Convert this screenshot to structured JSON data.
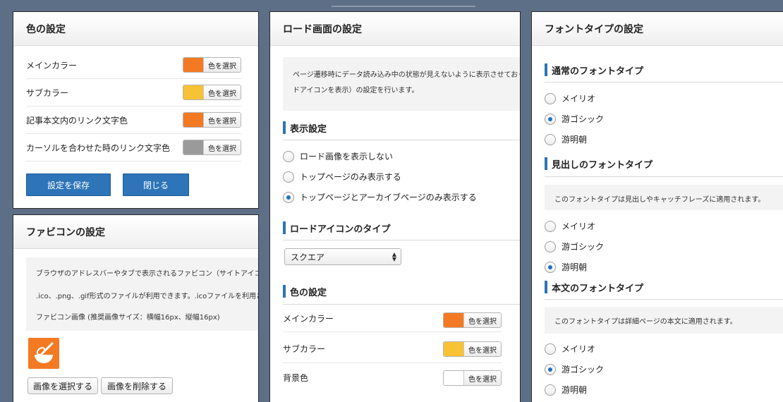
{
  "colors": {
    "orange": "#f37a22",
    "yellow": "#f7c233",
    "gray": "#9a9a9a",
    "white": "#ffffff",
    "primary_button": "#2d74b8",
    "section_marker": "#2d74b8"
  },
  "color_panel": {
    "title": "色の設定",
    "rows": [
      {
        "label": "メインカラー",
        "swatch": "#f37a22",
        "button": "色を選択"
      },
      {
        "label": "サブカラー",
        "swatch": "#f7c233",
        "button": "色を選択"
      },
      {
        "label": "記事本文内のリンク文字色",
        "swatch": "#f37a22",
        "button": "色を選択"
      },
      {
        "label": "カーソルを合わせた時のリンク文字色",
        "swatch": "#9a9a9a",
        "button": "色を選択"
      }
    ],
    "save_label": "設定を保存",
    "close_label": "閉じる"
  },
  "favicon_panel": {
    "title": "ファビコンの設定",
    "info_lines": [
      "ブラウザのアドレスバーやタブで表示されるファビコン（サイトアイコ",
      ".ico、.png、.gif形式のファイルが利用できます。.icoファイルを利用さ",
      "ファビコン画像 (推奨画像サイズ：横幅16px、縦幅16px)"
    ],
    "select_label": "画像を選択する",
    "delete_label": "画像を削除する"
  },
  "load_panel": {
    "title": "ロード画面の設定",
    "info_lines": [
      "ページ遷移時にデータ読み込み中の状態が見えないように表示させておく",
      "ドアイコンを表示）の設定を行います。"
    ],
    "display_title": "表示設定",
    "display_options": [
      {
        "label": "ロード画像を表示しない",
        "selected": false
      },
      {
        "label": "トップページのみ表示する",
        "selected": false
      },
      {
        "label": "トップページとアーカイブページのみ表示する",
        "selected": true
      }
    ],
    "icon_type_title": "ロードアイコンのタイプ",
    "icon_type_value": "スクエア",
    "color_title": "色の設定",
    "color_rows": [
      {
        "label": "メインカラー",
        "swatch": "#f37a22",
        "button": "色を選択"
      },
      {
        "label": "サブカラー",
        "swatch": "#f7c233",
        "button": "色を選択"
      },
      {
        "label": "背景色",
        "swatch": "#ffffff",
        "button": "色を選択"
      }
    ]
  },
  "font_panel": {
    "title": "フォントタイプの設定",
    "normal_title": "通常のフォントタイプ",
    "normal_options": [
      {
        "label": "メイリオ",
        "selected": false
      },
      {
        "label": "游ゴシック",
        "selected": true
      },
      {
        "label": "游明朝",
        "selected": false
      }
    ],
    "heading_title": "見出しのフォントタイプ",
    "heading_info": "このフォントタイプは見出しやキャッチフレーズに適用されます。",
    "heading_options": [
      {
        "label": "メイリオ",
        "selected": false
      },
      {
        "label": "游ゴシック",
        "selected": false
      },
      {
        "label": "游明朝",
        "selected": true
      }
    ],
    "body_title": "本文のフォントタイプ",
    "body_info": "このフォントタイプは詳細ページの本文に適用されます。",
    "body_options": [
      {
        "label": "メイリオ",
        "selected": false
      },
      {
        "label": "游ゴシック",
        "selected": true
      },
      {
        "label": "游明朝",
        "selected": false
      }
    ]
  }
}
